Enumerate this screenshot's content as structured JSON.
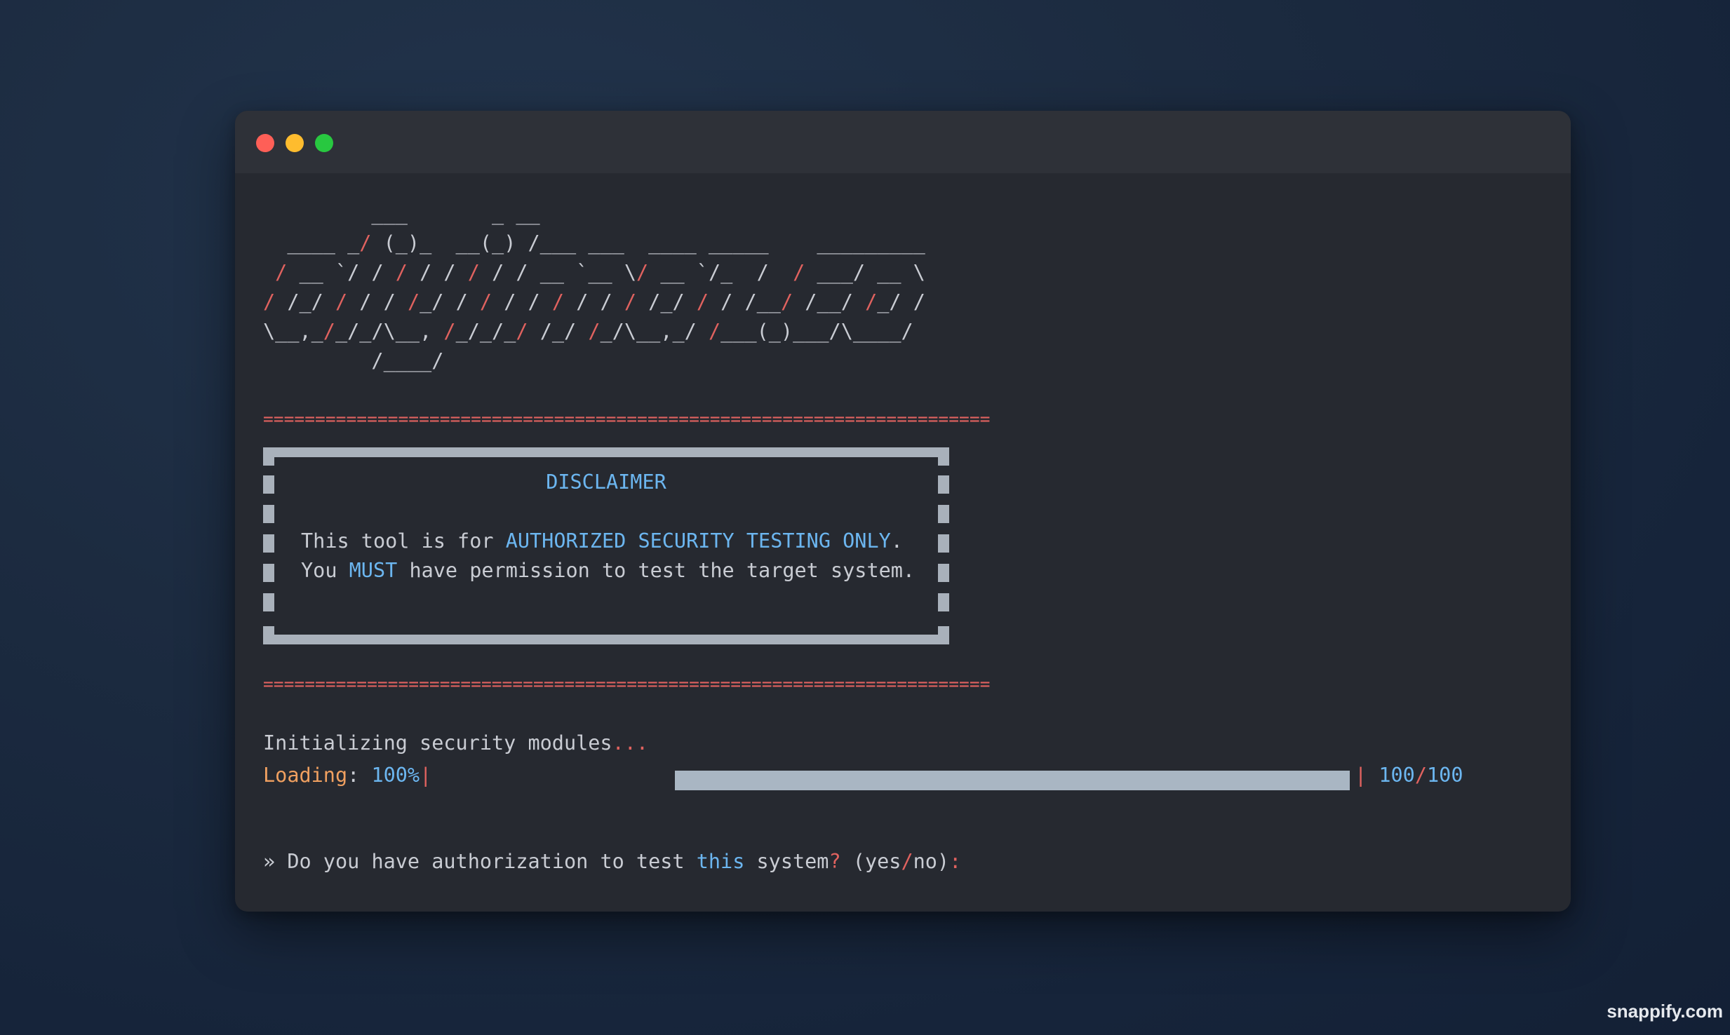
{
  "window": {
    "controls": [
      "close",
      "minimize",
      "zoom"
    ]
  },
  "terminal": {
    "ascii_art": [
      "         ___       _ __",
      "  ____ _/ (_)_  __(_) /___ ___  ____ _____    _________",
      " / __ `/ / / / / / / / __ `__ \\/ __ `/_  /  / ___/ __ \\",
      "/ /_/ / / / /_/ / / / / / / / / /_/ / / /__/ /__/ /_/ /",
      "\\__,_/_/_/\\__, /_/_/_/ /_/ /_/\\__,_/ /___(_)___/\\____/",
      "         /____/"
    ],
    "separator": "======================================================================",
    "disclaimer": {
      "title": "DISCLAIMER",
      "line1_a": "This tool is for ",
      "line1_b": "AUTHORIZED SECURITY TESTING ONLY",
      "line1_c": ".",
      "line2_a": "You ",
      "line2_b": "MUST",
      "line2_c": " have permission to test the target system."
    },
    "init_text": "Initializing security modules",
    "init_ellipsis": "...",
    "loading": {
      "label": "Loading",
      "colon": ": ",
      "percent": "100%",
      "pipe_open": "|",
      "pipe_close": "|",
      "count_current": "100",
      "count_slash": "/",
      "count_total": "100",
      "progress": 1.0
    },
    "prompt": {
      "arrow": "»",
      "text_a": " Do you have authorization to test ",
      "text_b": "this",
      "text_c": " system",
      "q": "?",
      "paren_open": " (yes",
      "slash": "/",
      "paren_close": "no)",
      "colon": ":"
    }
  },
  "watermark": "snappify.com",
  "colors": {
    "accent_red": "#e0625f",
    "accent_blue": "#6cb6f0",
    "accent_orange": "#f0a060",
    "text": "#c9ccd3",
    "window_bg": "#262930",
    "titlebar_bg": "#2e3138"
  }
}
